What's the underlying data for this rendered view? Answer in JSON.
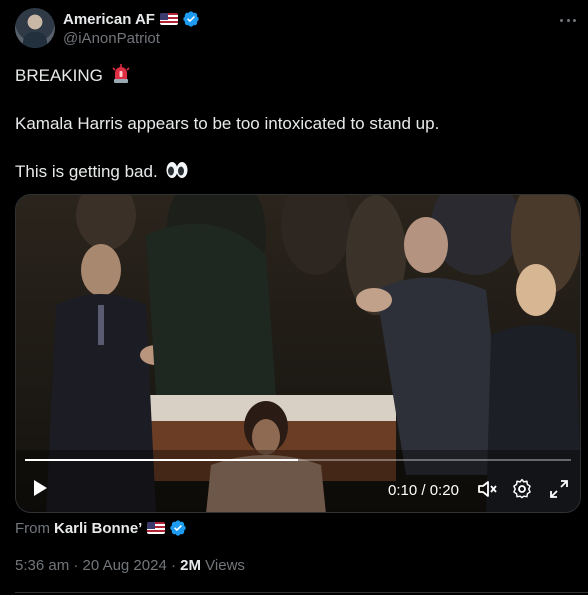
{
  "author": {
    "display_name": "American AF",
    "handle": "@iAnonPatriot"
  },
  "tweet": {
    "line1": "BREAKING",
    "line2": "Kamala Harris appears to be too intoxicated to stand up.",
    "line3": "This is getting bad."
  },
  "icons": {
    "siren": "police-siren-emoji",
    "eyes": "eyes-emoji",
    "verified": "verified-badge",
    "flag": "us-flag-emoji"
  },
  "video": {
    "current_time": "0:10",
    "separator": "/",
    "duration": "0:20",
    "progress": 0.5
  },
  "source": {
    "label": "From",
    "name": "Karli Bonne’"
  },
  "meta": {
    "time": "5:36 am",
    "date": "20 Aug 2024",
    "views_count": "2M",
    "views_label": "Views",
    "dot": "·"
  },
  "colors": {
    "accent_verified": "#1d9bf0",
    "secondary_text": "#71767b",
    "primary_text": "#e7e9ea"
  }
}
